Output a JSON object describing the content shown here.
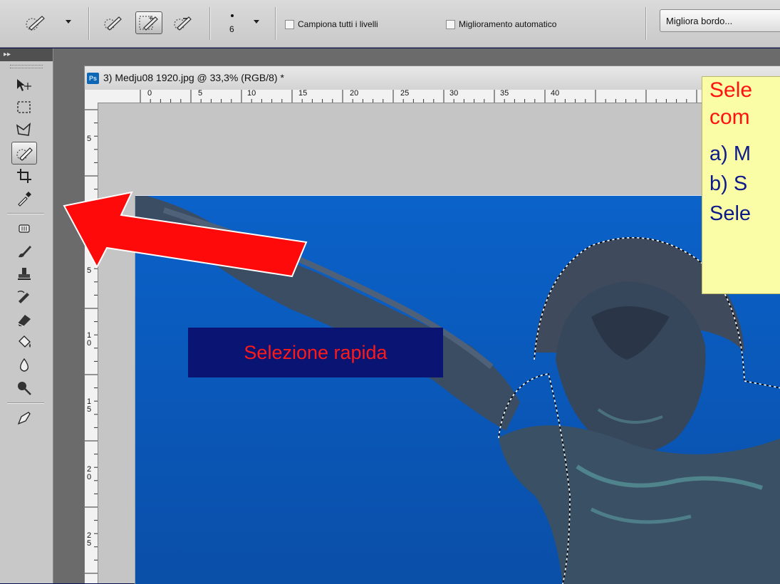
{
  "options_bar": {
    "tool_preset": {
      "icon": "quick-selection-icon"
    },
    "modes": [
      {
        "icon": "new-selection-brush-icon"
      },
      {
        "icon": "add-to-selection-brush-icon",
        "active": true
      },
      {
        "icon": "subtract-from-selection-brush-icon"
      }
    ],
    "brush_size": "6",
    "sample_all_layers": "Campiona tutti i livelli",
    "auto_enhance": "Miglioramento automatico",
    "refine_edge": "Migliora bordo..."
  },
  "tools_panel": {
    "collapse_label": "▸▸",
    "tools": [
      {
        "icon": "move-tool-icon"
      },
      {
        "icon": "rectangular-marquee-icon"
      },
      {
        "icon": "polygonal-lasso-icon"
      },
      {
        "icon": "quick-selection-icon",
        "selected": true
      },
      {
        "icon": "crop-icon"
      },
      {
        "icon": "eyedropper-icon"
      },
      {
        "icon": "healing-brush-icon"
      },
      {
        "icon": "brush-icon"
      },
      {
        "icon": "clone-stamp-icon"
      },
      {
        "icon": "history-brush-icon"
      },
      {
        "icon": "eraser-icon"
      },
      {
        "icon": "paint-bucket-icon"
      },
      {
        "icon": "blur-icon"
      },
      {
        "icon": "dodge-icon"
      },
      {
        "icon": "pen-icon"
      }
    ]
  },
  "document": {
    "badge": "Ps",
    "title": "3) Medju08 1920.jpg @ 33,3% (RGB/8) *",
    "h_ruler_labels": [
      "0",
      "5",
      "10",
      "15",
      "20",
      "25",
      "30",
      "35",
      "40"
    ],
    "v_ruler_labels": [
      "5",
      "5",
      "1 0",
      "1 5",
      "2 0",
      "2 5"
    ]
  },
  "annotation": {
    "label": "Selezione rapida",
    "arrow_color": "#ff0a0a",
    "note_lines": [
      "Sele",
      "com",
      "a) M",
      "b) S",
      "Sele"
    ]
  }
}
